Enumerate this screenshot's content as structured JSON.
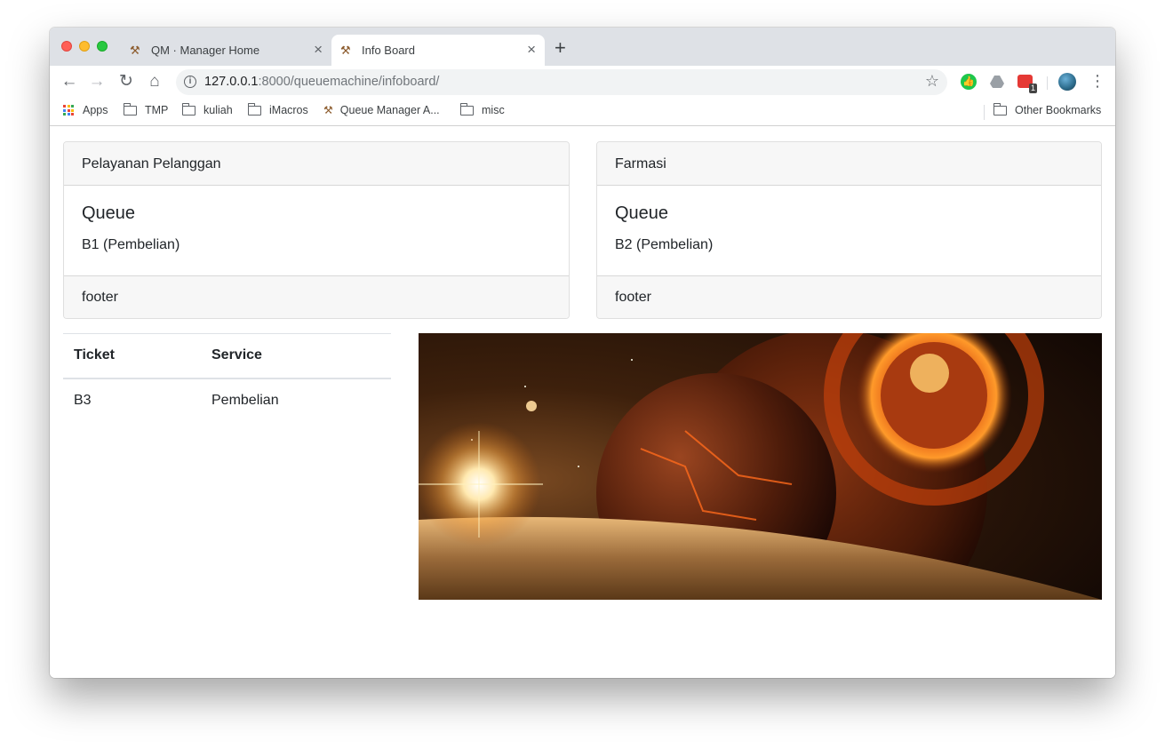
{
  "browser": {
    "tabs": [
      {
        "title": "QM · Manager Home",
        "active": false
      },
      {
        "title": "Info Board",
        "active": true
      }
    ],
    "address": {
      "host": "127.0.0.1",
      "path": ":8000/queuemachine/infoboard/"
    },
    "extensions": {
      "red_badge": "1"
    },
    "bookmarks": [
      {
        "label": "Apps",
        "icon": "apps-grid-icon"
      },
      {
        "label": "TMP",
        "icon": "folder-icon"
      },
      {
        "label": "kuliah",
        "icon": "folder-icon"
      },
      {
        "label": "iMacros",
        "icon": "folder-icon"
      },
      {
        "label": "Queue Manager A...",
        "icon": "tools-icon"
      },
      {
        "label": "misc",
        "icon": "folder-icon"
      }
    ],
    "other_bookmarks": "Other Bookmarks"
  },
  "cards": [
    {
      "header": "Pelayanan Pelanggan",
      "title": "Queue",
      "text": "B1 (Pembelian)",
      "footer": "footer"
    },
    {
      "header": "Farmasi",
      "title": "Queue",
      "text": "B2 (Pembelian)",
      "footer": "footer"
    }
  ],
  "table": {
    "headers": [
      "Ticket",
      "Service"
    ],
    "rows": [
      [
        "B3",
        "Pembelian"
      ]
    ]
  },
  "colors": {
    "card_bg": "#f7f7f7",
    "tabstrip_bg": "#dee1e6",
    "text": "#212529"
  }
}
